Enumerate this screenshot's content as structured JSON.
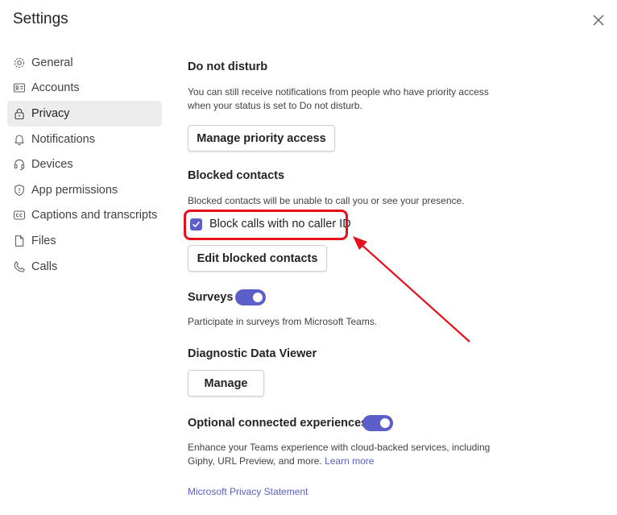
{
  "window": {
    "title": "Settings",
    "close_icon": "close-icon"
  },
  "sidebar": {
    "items": [
      {
        "label": "General",
        "icon": "gear-icon"
      },
      {
        "label": "Accounts",
        "icon": "id-card-icon"
      },
      {
        "label": "Privacy",
        "icon": "lock-icon",
        "active": true
      },
      {
        "label": "Notifications",
        "icon": "bell-icon"
      },
      {
        "label": "Devices",
        "icon": "headset-icon"
      },
      {
        "label": "App permissions",
        "icon": "shield-icon"
      },
      {
        "label": "Captions and transcripts",
        "icon": "closed-captions-icon"
      },
      {
        "label": "Files",
        "icon": "file-icon"
      },
      {
        "label": "Calls",
        "icon": "phone-icon"
      }
    ]
  },
  "dnd": {
    "heading": "Do not disturb",
    "description": "You can still receive notifications from people who have priority access when your status is set to Do not disturb.",
    "button": "Manage priority access"
  },
  "blocked": {
    "heading": "Blocked contacts",
    "description": "Blocked contacts will be unable to call you or see your presence.",
    "checkbox_label": "Block calls with no caller ID",
    "checkbox_checked": true,
    "button": "Edit blocked contacts"
  },
  "surveys": {
    "heading": "Surveys",
    "toggle_on": true,
    "description": "Participate in surveys from Microsoft Teams."
  },
  "diagnostic": {
    "heading": "Diagnostic Data Viewer",
    "button": "Manage"
  },
  "optional": {
    "heading": "Optional connected experiences",
    "toggle_on": true,
    "description": "Enhance your Teams experience with cloud-backed services, including Giphy, URL Preview, and more.",
    "learn_more": "Learn more"
  },
  "footer": {
    "privacy_link": "Microsoft Privacy Statement"
  },
  "colors": {
    "accent": "#5b5fc7",
    "annotation": "#e8111b",
    "active_nav": "#ececec"
  }
}
